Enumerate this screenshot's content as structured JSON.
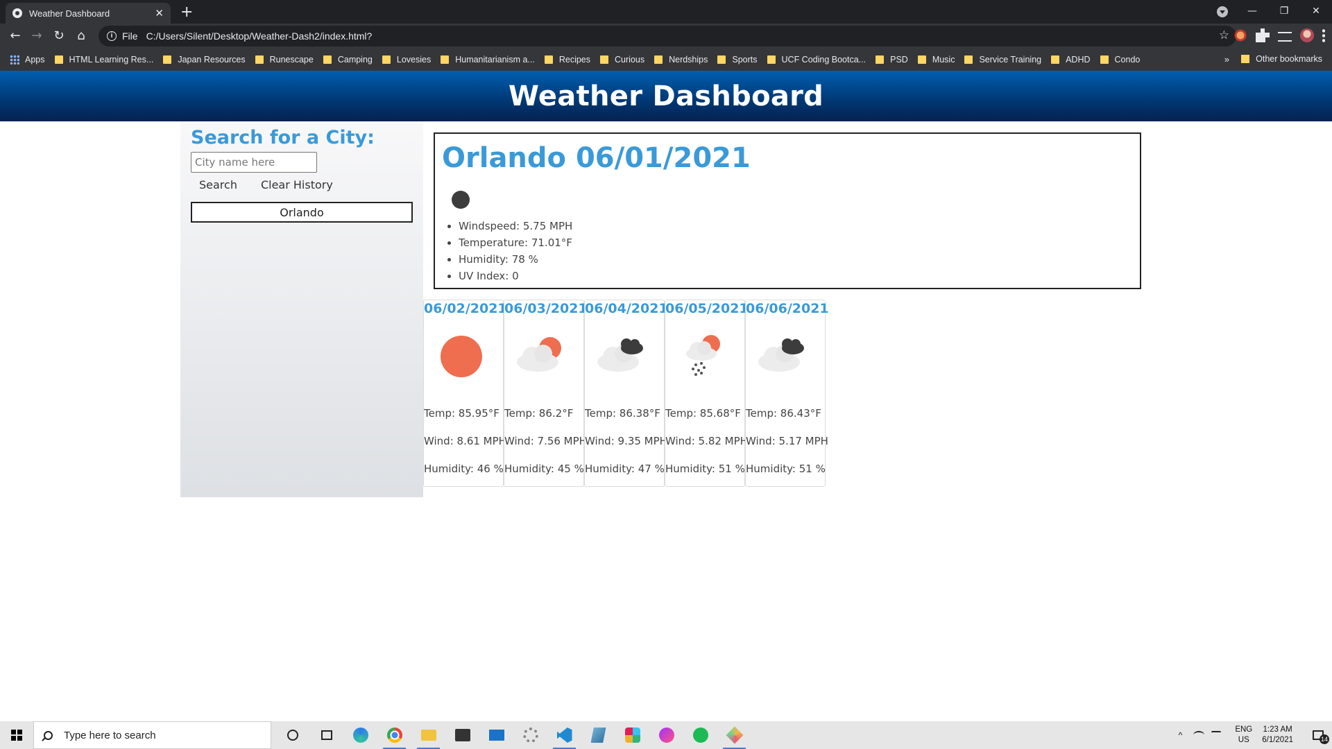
{
  "browser": {
    "tab_title": "Weather Dashboard",
    "tab_close": "✕",
    "new_tab": "+",
    "url_scheme": "File",
    "url": "C:/Users/Silent/Desktop/Weather-Dash2/index.html?",
    "window_controls": {
      "minimize": "—",
      "restore": "❐",
      "close": "✕"
    },
    "bookmarks": [
      "Apps",
      "HTML Learning Res...",
      "Japan Resources",
      "Runescape",
      "Camping",
      "Lovesies",
      "Humanitarianism a...",
      "Recipes",
      "Curious",
      "Nerdships",
      "Sports",
      "UCF Coding Bootca...",
      "PSD",
      "Music",
      "Service Training",
      "ADHD",
      "Condo"
    ],
    "bookmarks_overflow": "»",
    "other_bookmarks": "Other bookmarks"
  },
  "app": {
    "title": "Weather Dashboard"
  },
  "sidebar": {
    "heading": "Search for a City:",
    "input_placeholder": "City name here",
    "search_label": "Search",
    "clear_label": "Clear History",
    "history": [
      "Orlando"
    ]
  },
  "current": {
    "heading": "Orlando 06/01/2021",
    "icon": "dark-circle-icon",
    "windspeed": "Windspeed: 5.75 MPH",
    "temperature": "Temperature: 71.01°F",
    "humidity": "Humidity: 78 %",
    "uv_index": "UV Index: 0"
  },
  "forecast": [
    {
      "date": "06/02/2021",
      "icon": "sun-icon",
      "temp": "Temp: 85.95°F",
      "wind": "Wind: 8.61 MPH",
      "humidity": "Humidity: 46 %"
    },
    {
      "date": "06/03/2021",
      "icon": "partly-cloudy-icon",
      "temp": "Temp: 86.2°F",
      "wind": "Wind: 7.56 MPH",
      "humidity": "Humidity: 45 %"
    },
    {
      "date": "06/04/2021",
      "icon": "broken-clouds-icon",
      "temp": "Temp: 86.38°F",
      "wind": "Wind: 9.35 MPH",
      "humidity": "Humidity: 47 %"
    },
    {
      "date": "06/05/2021",
      "icon": "rain-icon",
      "temp": "Temp: 85.68°F",
      "wind": "Wind: 5.82 MPH",
      "humidity": "Humidity: 51 %"
    },
    {
      "date": "06/06/2021",
      "icon": "broken-clouds-icon",
      "temp": "Temp: 86.43°F",
      "wind": "Wind: 5.17 MPH",
      "humidity": "Humidity: 51 %"
    }
  ],
  "taskbar": {
    "search_placeholder": "Type here to search",
    "language": "ENG",
    "region": "US",
    "time": "1:23 AM",
    "date": "6/1/2021",
    "notification_count": "14",
    "caret": "^"
  },
  "colors": {
    "accent": "#3a9ad9",
    "header_top": "#005fb0",
    "header_bottom": "#06224f",
    "sun": "#ee6e4f"
  }
}
